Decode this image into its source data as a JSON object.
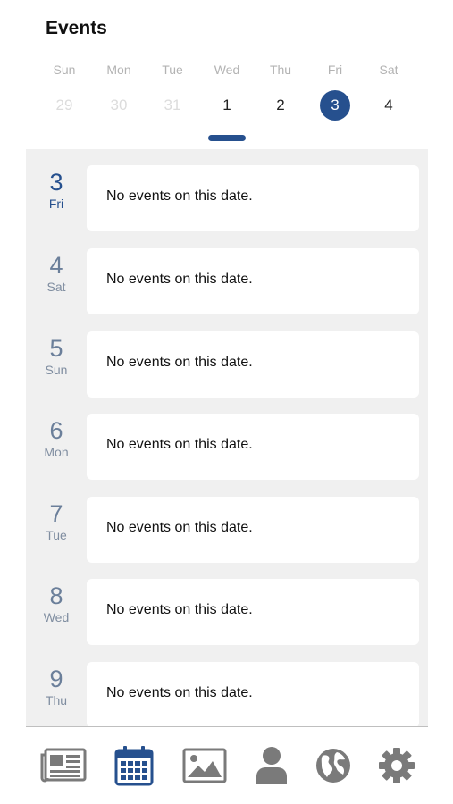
{
  "header": {
    "title": "Events"
  },
  "week": [
    {
      "name": "Sun",
      "num": "29",
      "state": "muted"
    },
    {
      "name": "Mon",
      "num": "30",
      "state": "muted"
    },
    {
      "name": "Tue",
      "num": "31",
      "state": "muted"
    },
    {
      "name": "Wed",
      "num": "1",
      "state": "normal"
    },
    {
      "name": "Thu",
      "num": "2",
      "state": "normal"
    },
    {
      "name": "Fri",
      "num": "3",
      "state": "selected"
    },
    {
      "name": "Sat",
      "num": "4",
      "state": "normal"
    }
  ],
  "events": [
    {
      "day": "3",
      "dow": "Fri",
      "text": "No events on this date.",
      "active": true
    },
    {
      "day": "4",
      "dow": "Sat",
      "text": "No events on this date.",
      "active": false
    },
    {
      "day": "5",
      "dow": "Sun",
      "text": "No events on this date.",
      "active": false
    },
    {
      "day": "6",
      "dow": "Mon",
      "text": "No events on this date.",
      "active": false
    },
    {
      "day": "7",
      "dow": "Tue",
      "text": "No events on this date.",
      "active": false
    },
    {
      "day": "8",
      "dow": "Wed",
      "text": "No events on this date.",
      "active": false
    },
    {
      "day": "9",
      "dow": "Thu",
      "text": "No events on this date.",
      "active": false
    }
  ],
  "tabs": [
    {
      "icon": "newspaper-icon",
      "active": false
    },
    {
      "icon": "calendar-icon",
      "active": true
    },
    {
      "icon": "image-icon",
      "active": false
    },
    {
      "icon": "person-icon",
      "active": false
    },
    {
      "icon": "globe-icon",
      "active": false
    },
    {
      "icon": "gear-icon",
      "active": false
    }
  ],
  "colors": {
    "accent": "#26508e",
    "inactive_icon": "#7a7a7a",
    "list_bg": "#f0f0f0"
  }
}
